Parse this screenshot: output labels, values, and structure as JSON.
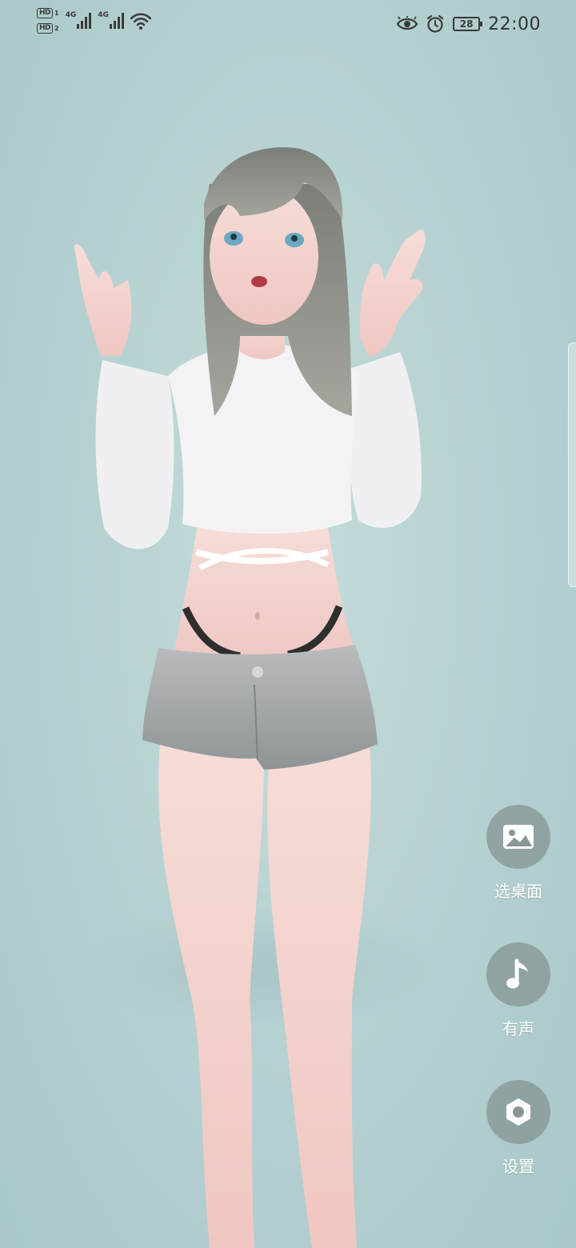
{
  "status_bar": {
    "hd1": "HD",
    "hd1_sim": "1",
    "hd2": "HD",
    "hd2_sim": "2",
    "net1": "4G",
    "net2": "4G",
    "battery": "28",
    "time": "22:00",
    "icons": [
      "eye-comfort-icon",
      "alarm-icon",
      "battery-icon",
      "wifi-icon",
      "signal-icon"
    ]
  },
  "actions": [
    {
      "label": "选桌面",
      "icon": "image-icon"
    },
    {
      "label": "有声",
      "icon": "music-note-icon"
    },
    {
      "label": "设置",
      "icon": "settings-hexagon-icon"
    }
  ],
  "colors": {
    "background": "#b7d3d3",
    "button_bg": "#87969680",
    "button_label": "#ffffff"
  }
}
